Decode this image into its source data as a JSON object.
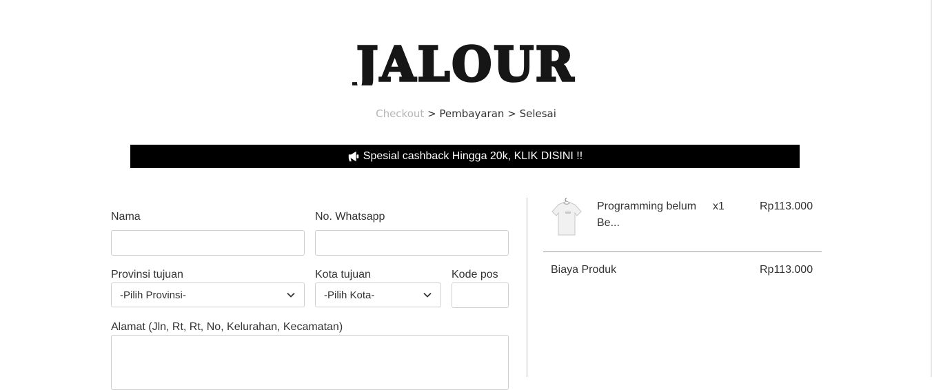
{
  "brand": {
    "logo_text": "JALOUR"
  },
  "breadcrumb": {
    "steps": [
      "Checkout",
      "Pembayaran",
      "Selesai"
    ],
    "separator": ">"
  },
  "banner": {
    "icon": "megaphone-icon",
    "text": "Spesial cashback Hingga 20k, KLIK DISINI !!"
  },
  "form": {
    "name_label": "Nama",
    "name_value": "",
    "whatsapp_label": "No. Whatsapp",
    "whatsapp_value": "",
    "province_label": "Provinsi tujuan",
    "province_selected": "-Pilih Provinsi-",
    "city_label": "Kota tujuan",
    "city_selected": "-Pilih Kota-",
    "postal_label": "Kode pos",
    "postal_value": "",
    "address_label": "Alamat (Jln, Rt, Rt, No, Kelurahan, Kecamatan)",
    "address_value": ""
  },
  "cart": {
    "items": [
      {
        "name_line1": "Programming belum",
        "name_line2": "Be...",
        "qty": "x1",
        "price": "Rp113.000",
        "thumb": "tshirt-icon"
      }
    ],
    "summary": {
      "label": "Biaya Produk",
      "value": "Rp113.000"
    }
  },
  "colors": {
    "banner_bg": "#000000",
    "banner_text": "#ffffff",
    "breadcrumb_active": "#b5b5b5",
    "border": "#cfcfcf"
  }
}
